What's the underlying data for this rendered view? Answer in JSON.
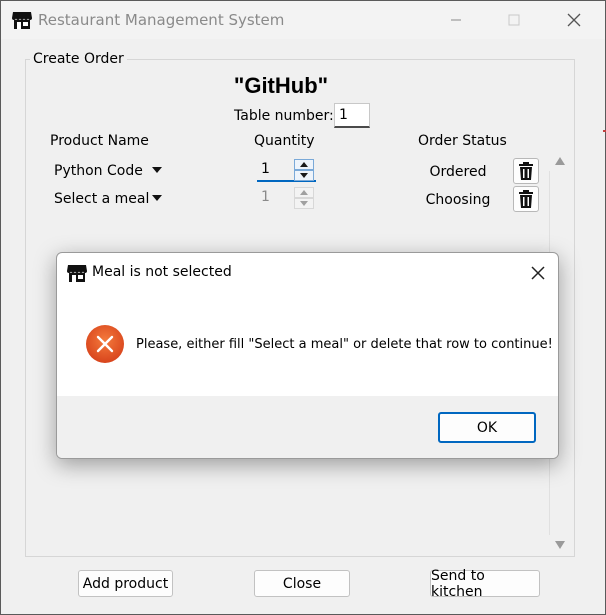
{
  "window": {
    "title": "Restaurant Management System",
    "icon": "storefront-icon"
  },
  "create_order": {
    "group_label": "Create Order",
    "order_title": "\"GitHub\"",
    "table_number_label": "Table number:",
    "table_number_value": "1",
    "columns": {
      "product": "Product Name",
      "quantity": "Quantity",
      "status": "Order Status"
    },
    "rows": [
      {
        "product": "Python Code",
        "quantity": "1",
        "status": "Ordered",
        "enabled": true
      },
      {
        "product": "Select a meal",
        "quantity": "1",
        "status": "Choosing",
        "enabled": false
      }
    ]
  },
  "buttons": {
    "add_product": "Add product",
    "close": "Close",
    "send_to_kitchen": "Send to kitchen"
  },
  "dialog": {
    "title": "Meal is not selected",
    "message": "Please, either fill \"Select a meal\" or delete that row to continue!",
    "ok_label": "OK",
    "icon": "error-icon"
  },
  "colors": {
    "accent": "#0067c0",
    "error": "#e05a2b"
  }
}
